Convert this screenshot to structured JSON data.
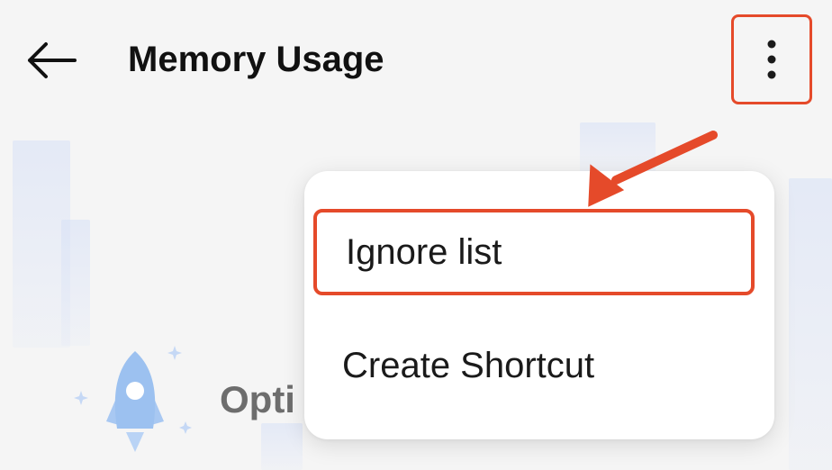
{
  "app_bar": {
    "title": "Memory Usage",
    "back_icon": "arrow-left-icon",
    "more_icon": "more-vertical-icon"
  },
  "background": {
    "optimize_label_partial": "Opti",
    "rocket_icon": "rocket-icon"
  },
  "menu": {
    "items": [
      {
        "label": "Ignore list",
        "highlighted": true
      },
      {
        "label": "Create Shortcut",
        "highlighted": false
      }
    ]
  },
  "colors": {
    "annotation": "#e54a2a",
    "background": "#f5f5f5",
    "title": "#111111",
    "rocket": "#8fb8f0"
  }
}
